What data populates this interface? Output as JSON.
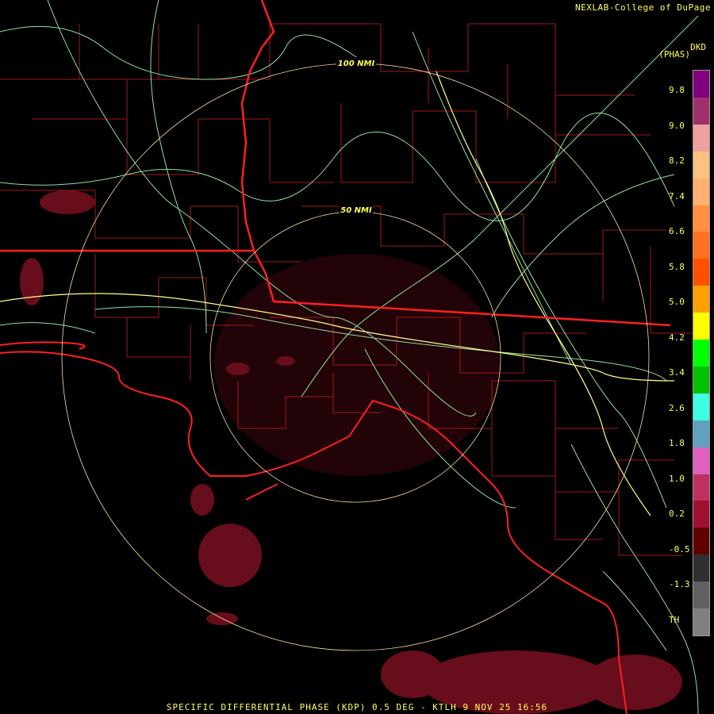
{
  "header": {
    "credit": "NEXLAB-College of DuPage",
    "unit": "DKD",
    "unit_sub": "(PHAS)"
  },
  "rings": [
    {
      "label": "100 NMI"
    },
    {
      "label": "50 NMI"
    }
  ],
  "colorbar": {
    "labels": [
      "9.8",
      "9.0",
      "8.2",
      "7.4",
      "6.6",
      "5.8",
      "5.0",
      "4.2",
      "3.4",
      "2.6",
      "1.8",
      "1.0",
      "0.2",
      "-0.5",
      "-1.3",
      "TH"
    ],
    "colors": [
      "#800080",
      "#a0306a",
      "#f0a0a0",
      "#ffc080",
      "#ffb070",
      "#ff9040",
      "#ff7020",
      "#ff5000",
      "#ffa000",
      "#ffff00",
      "#00ff00",
      "#00c000",
      "#40ffe0",
      "#60a0c0",
      "#e060c0",
      "#c03060",
      "#a01030",
      "#600000",
      "#303030",
      "#606060",
      "#808080"
    ],
    "accent_yellow": "#ffff55"
  },
  "footer": {
    "caption": "SPECIFIC DIFFERENTIAL PHASE (KDP) 0.5 DEG - KTLH 9 NOV 25 16:56"
  },
  "colors": {
    "county_lines": "#a01818",
    "state_lines": "#ff2020",
    "highways": "#90e0a0",
    "interstates": "#ffff88",
    "rings": "#ffe0a0",
    "echo": "#801020"
  }
}
